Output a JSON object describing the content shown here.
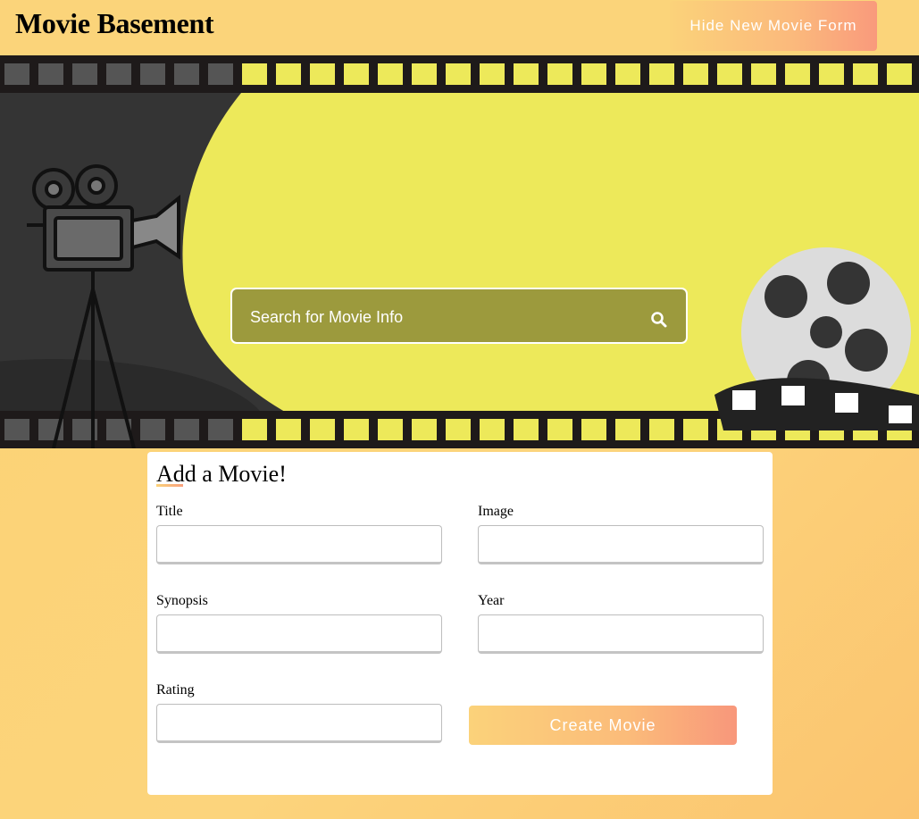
{
  "header": {
    "brand": "Movie Basement",
    "toggle_form_label": "Hide New Movie Form"
  },
  "search": {
    "placeholder": "Search for Movie Info",
    "icon": "search-icon"
  },
  "form": {
    "title": "Add a Movie!",
    "fields": {
      "title": {
        "label": "Title",
        "value": ""
      },
      "image": {
        "label": "Image",
        "value": ""
      },
      "synopsis": {
        "label": "Synopsis",
        "value": ""
      },
      "year": {
        "label": "Year",
        "value": ""
      },
      "rating": {
        "label": "Rating",
        "value": ""
      }
    },
    "submit_label": "Create Movie"
  },
  "colors": {
    "background": "#fbd27a",
    "accent_gradient_start": "#fbd27a",
    "accent_gradient_end": "#f8977b",
    "banner_yellow": "#ede95a",
    "banner_dark": "#343434",
    "search_box": "#9c9a3d"
  }
}
